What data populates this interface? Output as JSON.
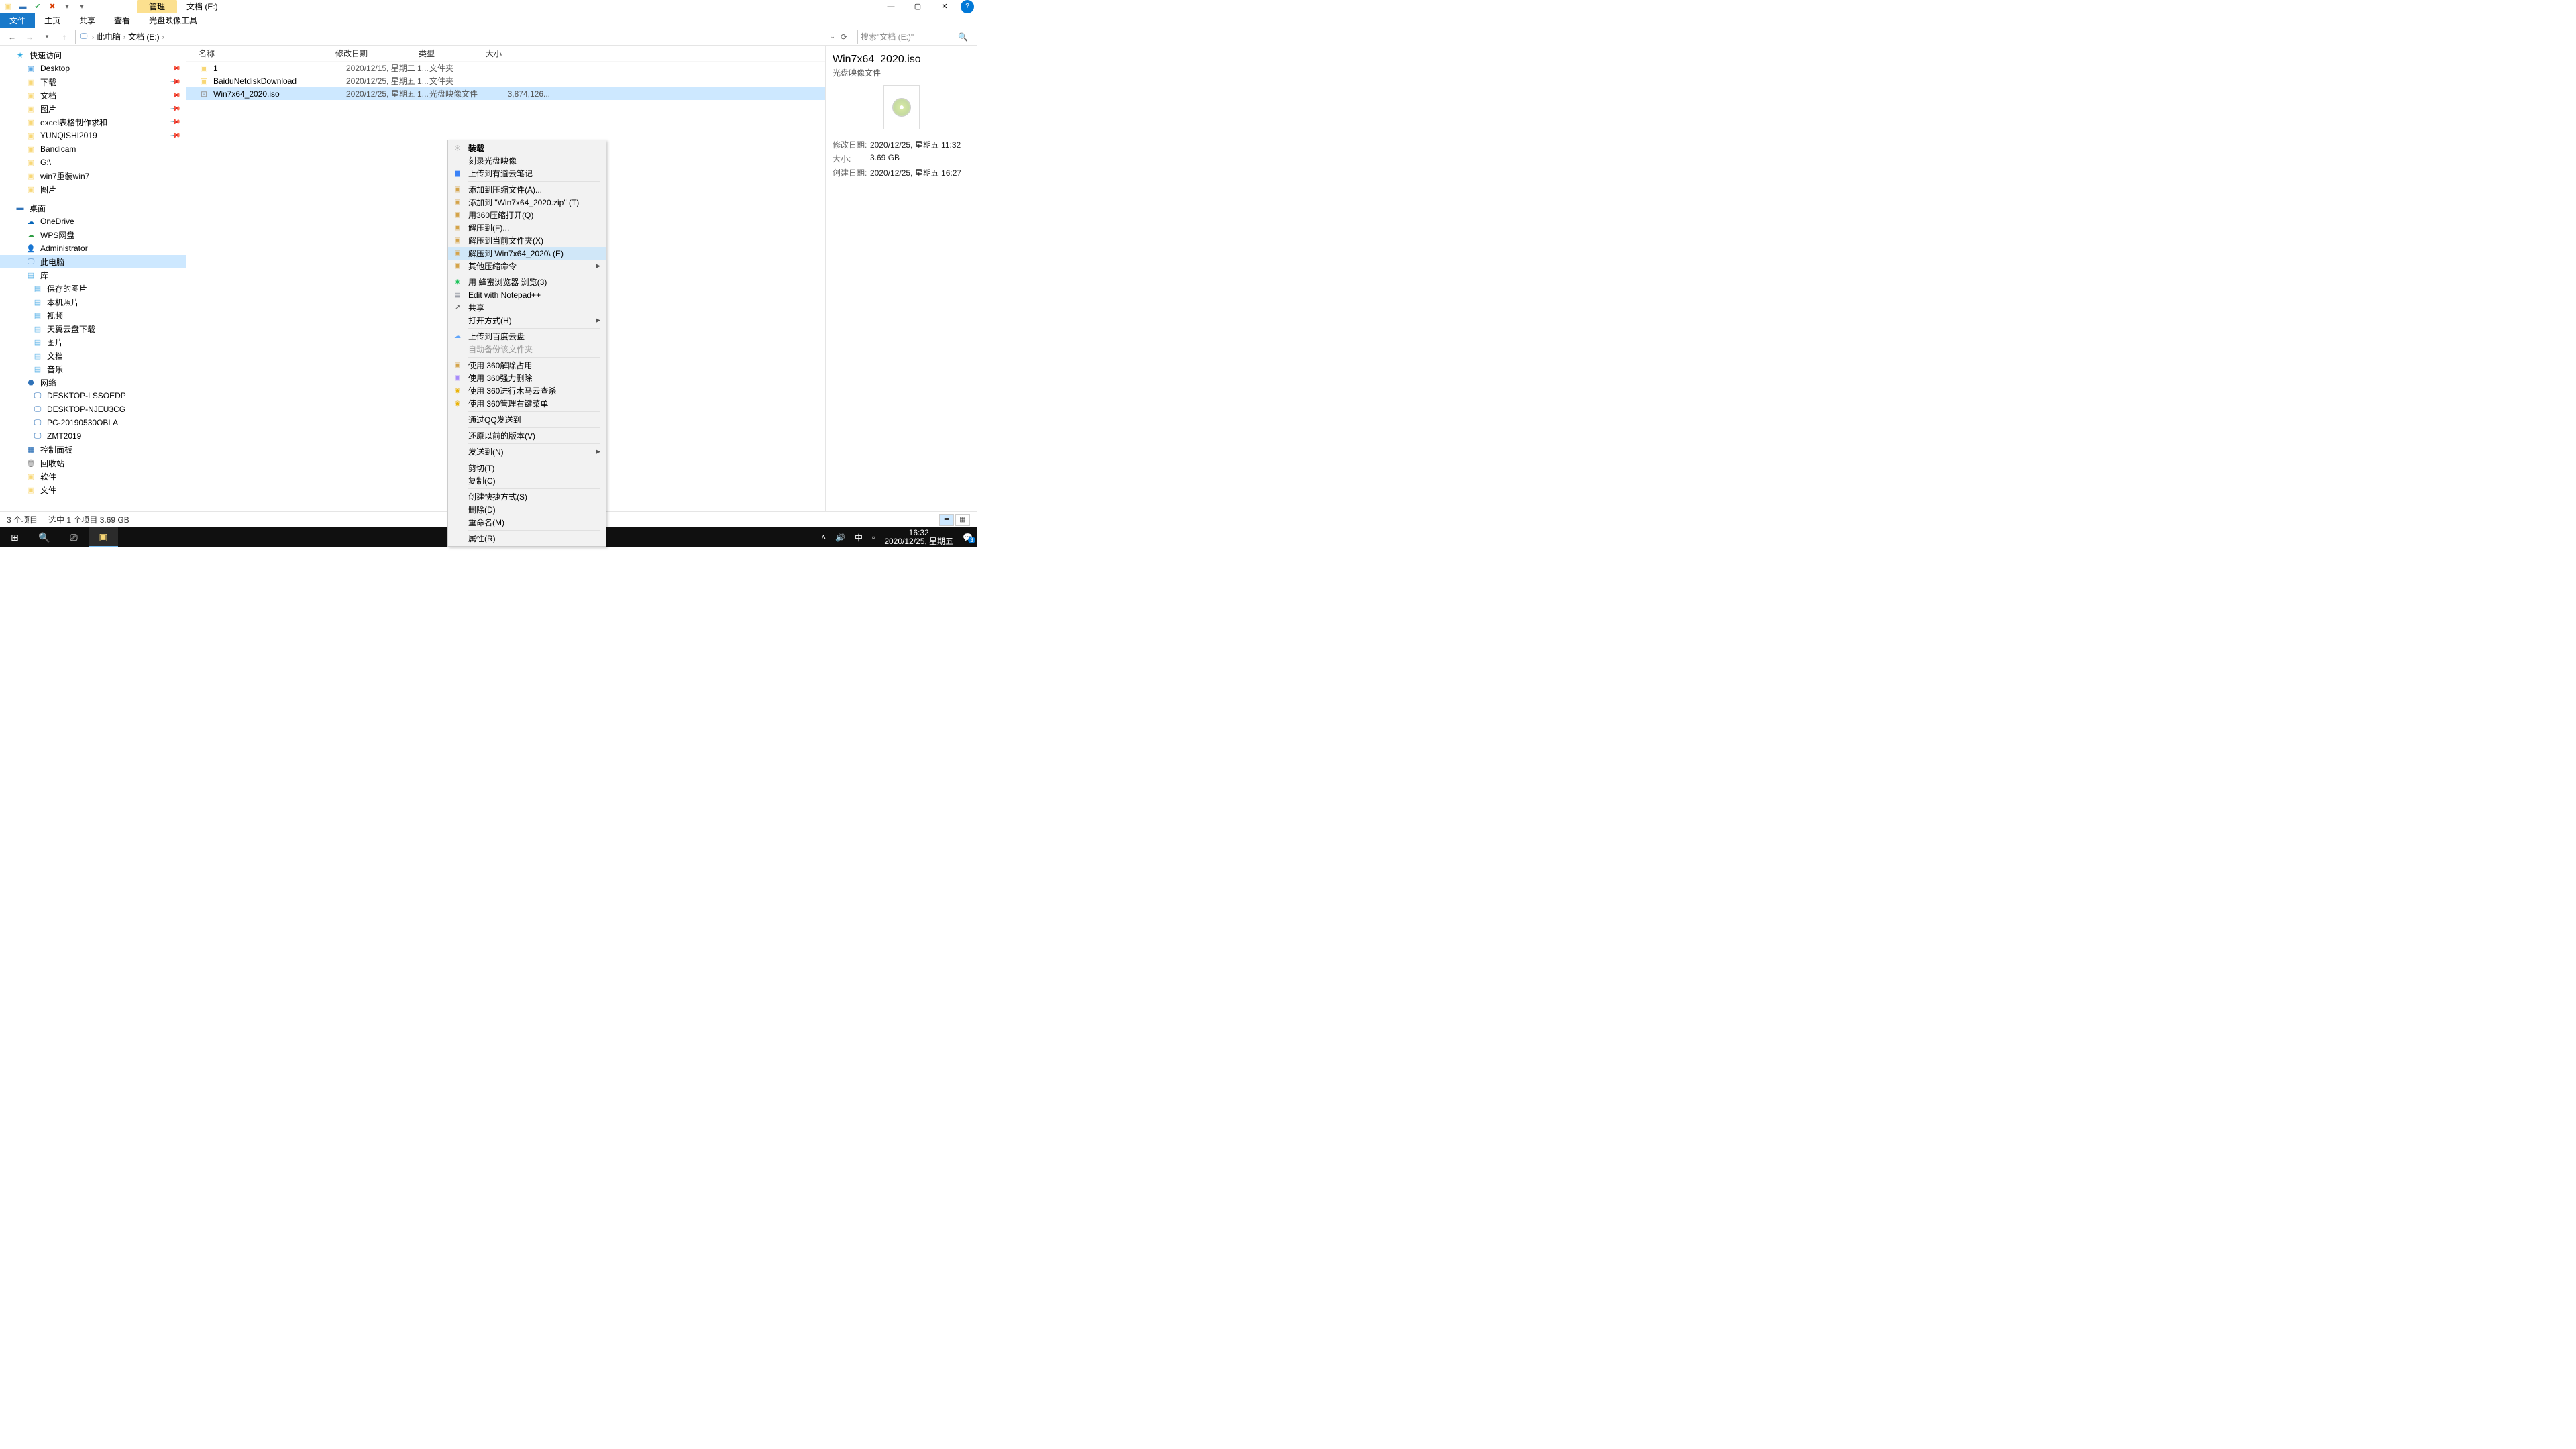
{
  "title_tab": "管理",
  "location_title": "文档 (E:)",
  "ribbon": {
    "file": "文件",
    "home": "主页",
    "share": "共享",
    "view": "查看",
    "disctool": "光盘映像工具"
  },
  "breadcrumb": {
    "pc": "此电脑",
    "drive": "文档 (E:)"
  },
  "search_placeholder": "搜索\"文档 (E:)\"",
  "sidebar": {
    "quick": "快速访问",
    "quick_items": [
      "Desktop",
      "下载",
      "文档",
      "图片",
      "excel表格制作求和",
      "YUNQISHI2019",
      "Bandicam",
      "G:\\",
      "win7重装win7",
      "图片"
    ],
    "desktop": "桌面",
    "desktop_items": [
      "OneDrive",
      "WPS网盘",
      "Administrator",
      "此电脑",
      "库"
    ],
    "lib_items": [
      "保存的图片",
      "本机照片",
      "视频",
      "天翼云盘下载",
      "图片",
      "文档",
      "音乐"
    ],
    "network": "网络",
    "net_items": [
      "DESKTOP-LSSOEDP",
      "DESKTOP-NJEU3CG",
      "PC-20190530OBLA",
      "ZMT2019"
    ],
    "ctrl": "控制面板",
    "recycle": "回收站",
    "soft": "软件",
    "wenj": "文件"
  },
  "columns": {
    "name": "名称",
    "date": "修改日期",
    "type": "类型",
    "size": "大小"
  },
  "rows": [
    {
      "name": "1",
      "date": "2020/12/15, 星期二 1...",
      "type": "文件夹",
      "size": "",
      "icon": "folder"
    },
    {
      "name": "BaiduNetdiskDownload",
      "date": "2020/12/25, 星期五 1...",
      "type": "文件夹",
      "size": "",
      "icon": "folder"
    },
    {
      "name": "Win7x64_2020.iso",
      "date": "2020/12/25, 星期五 1...",
      "type": "光盘映像文件",
      "size": "3,874,126...",
      "icon": "iso",
      "selected": true
    }
  ],
  "ctx": [
    {
      "label": "装载",
      "icon": "disc",
      "bold": true
    },
    {
      "label": "刻录光盘映像"
    },
    {
      "label": "上传到有道云笔记",
      "icon": "blue-sq"
    },
    {
      "sep": true
    },
    {
      "label": "添加到压缩文件(A)...",
      "icon": "archive"
    },
    {
      "label": "添加到 \"Win7x64_2020.zip\" (T)",
      "icon": "archive"
    },
    {
      "label": "用360压缩打开(Q)",
      "icon": "archive"
    },
    {
      "label": "解压到(F)...",
      "icon": "archive"
    },
    {
      "label": "解压到当前文件夹(X)",
      "icon": "archive"
    },
    {
      "label": "解压到 Win7x64_2020\\ (E)",
      "icon": "archive",
      "hover": true
    },
    {
      "label": "其他压缩命令",
      "icon": "archive",
      "arrow": true
    },
    {
      "sep": true
    },
    {
      "label": "用 蜂蜜浏览器 浏览(3)",
      "icon": "green-dot"
    },
    {
      "label": "Edit with Notepad++",
      "icon": "npp"
    },
    {
      "label": "共享",
      "icon": "share"
    },
    {
      "label": "打开方式(H)",
      "arrow": true
    },
    {
      "sep": true
    },
    {
      "label": "上传到百度云盘",
      "icon": "cloud"
    },
    {
      "label": "自动备份该文件夹",
      "disabled": true
    },
    {
      "sep": true
    },
    {
      "label": "使用 360解除占用",
      "icon": "sq-y"
    },
    {
      "label": "使用 360强力删除",
      "icon": "sq-p"
    },
    {
      "label": "使用 360进行木马云查杀",
      "icon": "sq-g"
    },
    {
      "label": "使用 360管理右键菜单",
      "icon": "sq-g"
    },
    {
      "sep": true
    },
    {
      "label": "通过QQ发送到"
    },
    {
      "sep": true
    },
    {
      "label": "还原以前的版本(V)"
    },
    {
      "sep": true
    },
    {
      "label": "发送到(N)",
      "arrow": true
    },
    {
      "sep": true
    },
    {
      "label": "剪切(T)"
    },
    {
      "label": "复制(C)"
    },
    {
      "sep": true
    },
    {
      "label": "创建快捷方式(S)"
    },
    {
      "label": "删除(D)"
    },
    {
      "label": "重命名(M)"
    },
    {
      "sep": true
    },
    {
      "label": "属性(R)"
    }
  ],
  "details": {
    "title": "Win7x64_2020.iso",
    "subtitle": "光盘映像文件",
    "rows": [
      {
        "label": "修改日期:",
        "value": "2020/12/25, 星期五 11:32"
      },
      {
        "label": "大小:",
        "value": "3.69 GB"
      },
      {
        "label": "创建日期:",
        "value": "2020/12/25, 星期五 16:27"
      }
    ]
  },
  "status": {
    "count": "3 个项目",
    "sel": "选中 1 个项目  3.69 GB"
  },
  "tray": {
    "ime": "中",
    "time": "16:32",
    "date": "2020/12/25, 星期五",
    "notif": "3"
  }
}
